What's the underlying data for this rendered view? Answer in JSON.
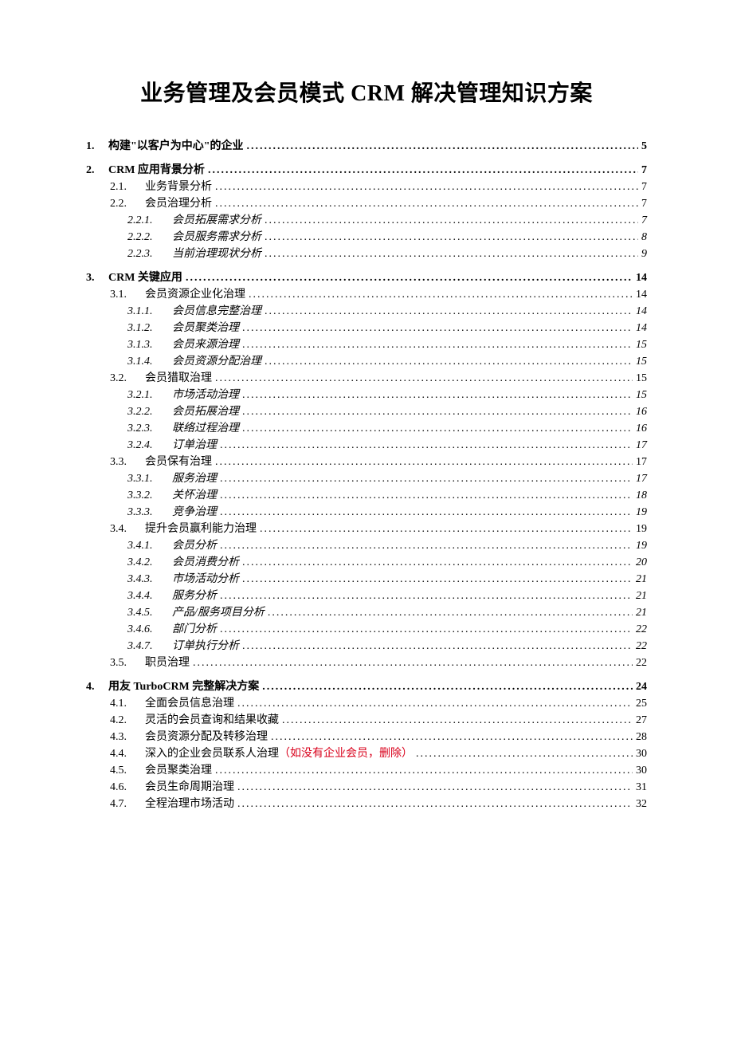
{
  "title": "业务管理及会员模式 CRM 解决管理知识方案",
  "toc": [
    {
      "level": 1,
      "num": "1.",
      "text": "构建\"以客户为中心\"的企业",
      "page": "5"
    },
    {
      "level": 1,
      "num": "2.",
      "text": "CRM 应用背景分析",
      "page": "7"
    },
    {
      "level": 2,
      "num": "2.1.",
      "text": "业务背景分析",
      "page": "7"
    },
    {
      "level": 2,
      "num": "2.2.",
      "text": "会员治理分析",
      "page": "7"
    },
    {
      "level": 3,
      "num": "2.2.1.",
      "text": "会员拓展需求分析",
      "page": "7"
    },
    {
      "level": 3,
      "num": "2.2.2.",
      "text": "会员服务需求分析",
      "page": "8"
    },
    {
      "level": 3,
      "num": "2.2.3.",
      "text": "当前治理现状分析",
      "page": "9"
    },
    {
      "level": 1,
      "num": "3.",
      "text": "CRM 关键应用",
      "page": "14"
    },
    {
      "level": 2,
      "num": "3.1.",
      "text": "会员资源企业化治理",
      "page": "14"
    },
    {
      "level": 3,
      "num": "3.1.1.",
      "text": "会员信息完整治理",
      "page": "14"
    },
    {
      "level": 3,
      "num": "3.1.2.",
      "text": "会员聚类治理",
      "page": "14"
    },
    {
      "level": 3,
      "num": "3.1.3.",
      "text": "会员来源治理",
      "page": "15"
    },
    {
      "level": 3,
      "num": "3.1.4.",
      "text": "会员资源分配治理",
      "page": "15"
    },
    {
      "level": 2,
      "num": "3.2.",
      "text": "会员猎取治理",
      "page": "15"
    },
    {
      "level": 3,
      "num": "3.2.1.",
      "text": "市场活动治理",
      "page": "15"
    },
    {
      "level": 3,
      "num": "3.2.2.",
      "text": "会员拓展治理",
      "page": "16"
    },
    {
      "level": 3,
      "num": "3.2.3.",
      "text": "联络过程治理",
      "page": "16"
    },
    {
      "level": 3,
      "num": "3.2.4.",
      "text": "订单治理",
      "page": "17"
    },
    {
      "level": 2,
      "num": "3.3.",
      "text": "会员保有治理",
      "page": "17"
    },
    {
      "level": 3,
      "num": "3.3.1.",
      "text": "服务治理",
      "page": "17"
    },
    {
      "level": 3,
      "num": "3.3.2.",
      "text": "关怀治理",
      "page": "18"
    },
    {
      "level": 3,
      "num": "3.3.3.",
      "text": "竞争治理",
      "page": "19"
    },
    {
      "level": 2,
      "num": "3.4.",
      "text": "提升会员赢利能力治理",
      "page": "19"
    },
    {
      "level": 3,
      "num": "3.4.1.",
      "text": "会员分析",
      "page": "19"
    },
    {
      "level": 3,
      "num": "3.4.2.",
      "text": "会员消费分析",
      "page": "20"
    },
    {
      "level": 3,
      "num": "3.4.3.",
      "text": "市场活动分析",
      "page": "21"
    },
    {
      "level": 3,
      "num": "3.4.4.",
      "text": "服务分析",
      "page": "21"
    },
    {
      "level": 3,
      "num": "3.4.5.",
      "text": "产品/服务项目分析",
      "page": "21"
    },
    {
      "level": 3,
      "num": "3.4.6.",
      "text": "部门分析",
      "page": "22"
    },
    {
      "level": 3,
      "num": "3.4.7.",
      "text": "订单执行分析",
      "page": "22"
    },
    {
      "level": 2,
      "num": "3.5.",
      "text": "职员治理",
      "page": "22"
    },
    {
      "level": 1,
      "num": "4.",
      "text": "用友 TurboCRM 完整解决方案",
      "page": "24"
    },
    {
      "level": 2,
      "num": "4.1.",
      "text": "全面会员信息治理",
      "page": "25"
    },
    {
      "level": 2,
      "num": "4.2.",
      "text": "灵活的会员查询和结果收藏",
      "page": "27"
    },
    {
      "level": 2,
      "num": "4.3.",
      "text": "会员资源分配及转移治理",
      "page": "28"
    },
    {
      "level": 2,
      "num": "4.4.",
      "text": "深入的企业会员联系人治理",
      "highlight": "（如没有企业会员，删除）",
      "page": "30"
    },
    {
      "level": 2,
      "num": "4.5.",
      "text": "会员聚类治理",
      "page": "30"
    },
    {
      "level": 2,
      "num": "4.6.",
      "text": "会员生命周期治理",
      "page": "31"
    },
    {
      "level": 2,
      "num": "4.7.",
      "text": "全程治理市场活动",
      "page": "32"
    }
  ]
}
